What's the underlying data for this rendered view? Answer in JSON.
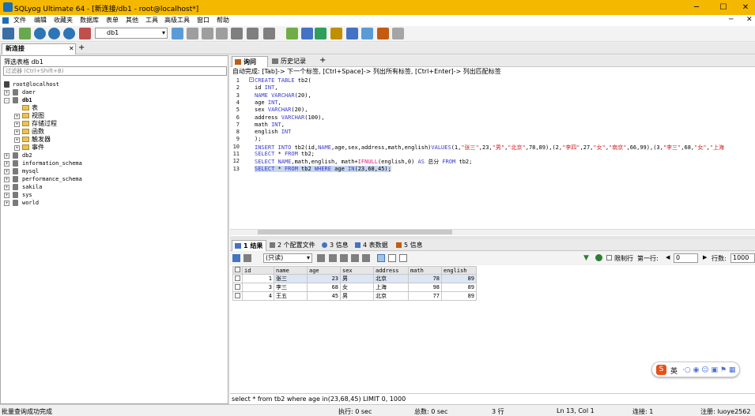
{
  "window": {
    "title": "SQLyog Ultimate 64 - [新连接/db1 - root@localhost*]",
    "minimize": "─",
    "maximize": "☐",
    "close": "✕"
  },
  "menu": [
    "文件",
    "编辑",
    "收藏夹",
    "数据库",
    "表单",
    "其他",
    "工具",
    "高级工具",
    "窗口",
    "帮助"
  ],
  "toolbar": {
    "db_selected": "db1"
  },
  "connection_tab": {
    "label": "新连接",
    "close": "✕",
    "add": "+"
  },
  "left": {
    "filter_label": "筛选表格 db1",
    "filter_placeholder": "过滤器 (Ctrl+Shift+B)",
    "root": "root@localhost",
    "tree": [
      {
        "label": "daer",
        "exp": "+"
      },
      {
        "label": "db1",
        "exp": "-",
        "children": [
          "表",
          "视图",
          "存储过程",
          "函数",
          "触发器",
          "事件"
        ]
      },
      {
        "label": "db2",
        "exp": "+"
      },
      {
        "label": "information_schema",
        "exp": "+"
      },
      {
        "label": "mysql",
        "exp": "+"
      },
      {
        "label": "performance_schema",
        "exp": "+"
      },
      {
        "label": "sakila",
        "exp": "+"
      },
      {
        "label": "sys",
        "exp": "+"
      },
      {
        "label": "world",
        "exp": "+"
      }
    ]
  },
  "editor": {
    "tabs": [
      "询问",
      "历史记录"
    ],
    "add": "+",
    "hint": "自动完成: [Tab]-> 下一个标签, [Ctrl+Space]-> 列出所有标签, [Ctrl+Enter]-> 列出匹配标签",
    "line_numbers": [
      "1",
      "2",
      "3",
      "4",
      "5",
      "6",
      "7",
      "8",
      "9",
      "10",
      "11",
      "12",
      "13"
    ],
    "lines": [
      "CREATE TABLE tb2(",
      "id INT,",
      "NAME VARCHAR(20),",
      "age INT,",
      "sex VARCHAR(20),",
      "address VARCHAR(100),",
      "math INT,",
      "english INT",
      ");",
      "INSERT INTO tb2(id,NAME,age,sex,address,math,english)VALUES(1,\"张三\",23,\"男\",\"北京\",78,89),(2,\"李四\",27,\"女\",\"南京\",66,99),(3,\"李三\",68,\"女\",\"上海",
      "SELECT * FROM tb2;",
      "SELECT NAME,math,english, math+IFNULL(english,0) AS 总分 FROM tb2;",
      "SELECT * FROM tb2 WHERE age IN(23,68,45);"
    ]
  },
  "results": {
    "tabs": [
      "1 结果",
      "2 个配置文件",
      "3 信息",
      "4 表数据",
      "5 信息"
    ],
    "readonly": "(只读)",
    "limit_label": "限制行",
    "first_row_label": "第一行:",
    "first_row_value": "0",
    "rows_label": "行数:",
    "rows_value": "1000",
    "columns": [
      "id",
      "name",
      "age",
      "sex",
      "address",
      "math",
      "english"
    ],
    "rows": [
      [
        "1",
        "张三",
        "23",
        "男",
        "北京",
        "78",
        "89"
      ],
      [
        "3",
        "李三",
        "68",
        "女",
        "上海",
        "98",
        "89"
      ],
      [
        "4",
        "王五",
        "45",
        "男",
        "北京",
        "77",
        "89"
      ]
    ],
    "query": "select * from tb2 where age in(23,68,45) LIMIT 0, 1000"
  },
  "status": {
    "left": "批量查询成功完成",
    "exec": "执行: 0 sec",
    "total": "总数: 0 sec",
    "rows": "3 行",
    "pos": "Ln 13, Col 1",
    "conn": "连接: 1",
    "reg": "注册: luoye2562"
  },
  "ime": {
    "label": "英"
  }
}
